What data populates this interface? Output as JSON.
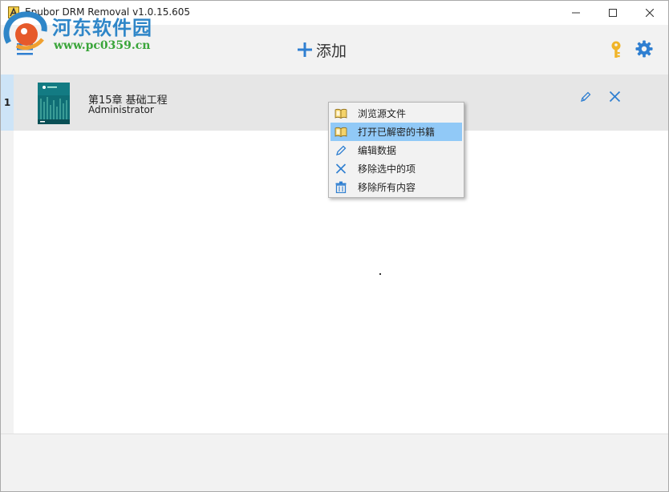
{
  "window": {
    "title": "Epubor DRM Removal v1.0.15.605"
  },
  "watermark": {
    "site_name": "河东软件园",
    "url": "www.pc0359.cn"
  },
  "toolbar": {
    "add_label": "添加"
  },
  "books": [
    {
      "index": "1",
      "title": "第15章 基础工程",
      "author": "Administrator"
    }
  ],
  "context_menu": {
    "items": [
      {
        "label": "浏览源文件",
        "icon": "open-book-icon"
      },
      {
        "label": "打开已解密的书籍",
        "icon": "open-book-icon",
        "highlighted": true
      },
      {
        "label": "编辑数据",
        "icon": "pencil-icon"
      },
      {
        "label": "移除选中的项",
        "icon": "close-x-icon"
      },
      {
        "label": "移除所有内容",
        "icon": "trash-icon"
      }
    ]
  },
  "colors": {
    "accent_blue": "#2f7fd1",
    "highlight": "#91c9f7",
    "key_gold": "#f0b428",
    "toolbar_bg": "#f2f2f2",
    "row_bg": "#e6e6e6",
    "row_index_bg": "#cde4f7"
  }
}
